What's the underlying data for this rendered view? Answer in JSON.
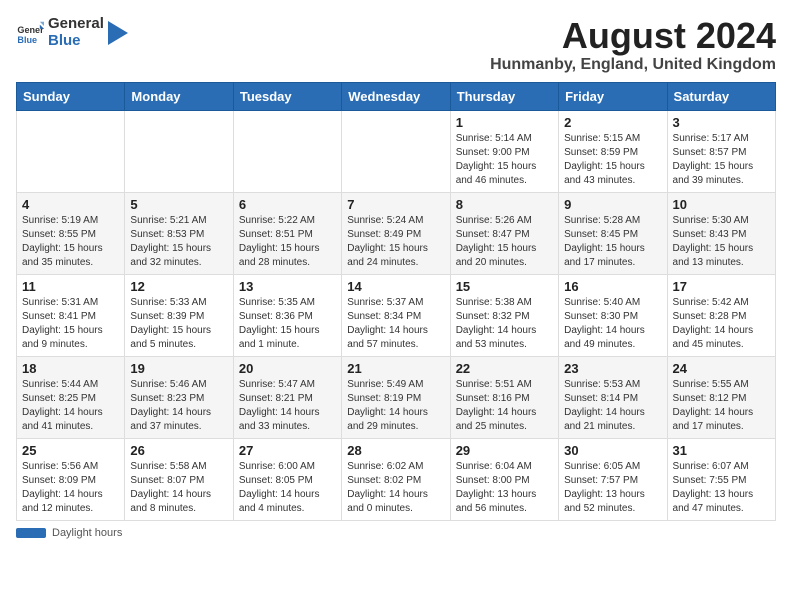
{
  "logo": {
    "general": "General",
    "blue": "Blue"
  },
  "title": "August 2024",
  "location": "Hunmanby, England, United Kingdom",
  "columns": [
    "Sunday",
    "Monday",
    "Tuesday",
    "Wednesday",
    "Thursday",
    "Friday",
    "Saturday"
  ],
  "footer": {
    "bar_label": "Daylight hours"
  },
  "weeks": [
    [
      {
        "num": "",
        "info": ""
      },
      {
        "num": "",
        "info": ""
      },
      {
        "num": "",
        "info": ""
      },
      {
        "num": "",
        "info": ""
      },
      {
        "num": "1",
        "info": "Sunrise: 5:14 AM\nSunset: 9:00 PM\nDaylight: 15 hours\nand 46 minutes."
      },
      {
        "num": "2",
        "info": "Sunrise: 5:15 AM\nSunset: 8:59 PM\nDaylight: 15 hours\nand 43 minutes."
      },
      {
        "num": "3",
        "info": "Sunrise: 5:17 AM\nSunset: 8:57 PM\nDaylight: 15 hours\nand 39 minutes."
      }
    ],
    [
      {
        "num": "4",
        "info": "Sunrise: 5:19 AM\nSunset: 8:55 PM\nDaylight: 15 hours\nand 35 minutes."
      },
      {
        "num": "5",
        "info": "Sunrise: 5:21 AM\nSunset: 8:53 PM\nDaylight: 15 hours\nand 32 minutes."
      },
      {
        "num": "6",
        "info": "Sunrise: 5:22 AM\nSunset: 8:51 PM\nDaylight: 15 hours\nand 28 minutes."
      },
      {
        "num": "7",
        "info": "Sunrise: 5:24 AM\nSunset: 8:49 PM\nDaylight: 15 hours\nand 24 minutes."
      },
      {
        "num": "8",
        "info": "Sunrise: 5:26 AM\nSunset: 8:47 PM\nDaylight: 15 hours\nand 20 minutes."
      },
      {
        "num": "9",
        "info": "Sunrise: 5:28 AM\nSunset: 8:45 PM\nDaylight: 15 hours\nand 17 minutes."
      },
      {
        "num": "10",
        "info": "Sunrise: 5:30 AM\nSunset: 8:43 PM\nDaylight: 15 hours\nand 13 minutes."
      }
    ],
    [
      {
        "num": "11",
        "info": "Sunrise: 5:31 AM\nSunset: 8:41 PM\nDaylight: 15 hours\nand 9 minutes."
      },
      {
        "num": "12",
        "info": "Sunrise: 5:33 AM\nSunset: 8:39 PM\nDaylight: 15 hours\nand 5 minutes."
      },
      {
        "num": "13",
        "info": "Sunrise: 5:35 AM\nSunset: 8:36 PM\nDaylight: 15 hours\nand 1 minute."
      },
      {
        "num": "14",
        "info": "Sunrise: 5:37 AM\nSunset: 8:34 PM\nDaylight: 14 hours\nand 57 minutes."
      },
      {
        "num": "15",
        "info": "Sunrise: 5:38 AM\nSunset: 8:32 PM\nDaylight: 14 hours\nand 53 minutes."
      },
      {
        "num": "16",
        "info": "Sunrise: 5:40 AM\nSunset: 8:30 PM\nDaylight: 14 hours\nand 49 minutes."
      },
      {
        "num": "17",
        "info": "Sunrise: 5:42 AM\nSunset: 8:28 PM\nDaylight: 14 hours\nand 45 minutes."
      }
    ],
    [
      {
        "num": "18",
        "info": "Sunrise: 5:44 AM\nSunset: 8:25 PM\nDaylight: 14 hours\nand 41 minutes."
      },
      {
        "num": "19",
        "info": "Sunrise: 5:46 AM\nSunset: 8:23 PM\nDaylight: 14 hours\nand 37 minutes."
      },
      {
        "num": "20",
        "info": "Sunrise: 5:47 AM\nSunset: 8:21 PM\nDaylight: 14 hours\nand 33 minutes."
      },
      {
        "num": "21",
        "info": "Sunrise: 5:49 AM\nSunset: 8:19 PM\nDaylight: 14 hours\nand 29 minutes."
      },
      {
        "num": "22",
        "info": "Sunrise: 5:51 AM\nSunset: 8:16 PM\nDaylight: 14 hours\nand 25 minutes."
      },
      {
        "num": "23",
        "info": "Sunrise: 5:53 AM\nSunset: 8:14 PM\nDaylight: 14 hours\nand 21 minutes."
      },
      {
        "num": "24",
        "info": "Sunrise: 5:55 AM\nSunset: 8:12 PM\nDaylight: 14 hours\nand 17 minutes."
      }
    ],
    [
      {
        "num": "25",
        "info": "Sunrise: 5:56 AM\nSunset: 8:09 PM\nDaylight: 14 hours\nand 12 minutes."
      },
      {
        "num": "26",
        "info": "Sunrise: 5:58 AM\nSunset: 8:07 PM\nDaylight: 14 hours\nand 8 minutes."
      },
      {
        "num": "27",
        "info": "Sunrise: 6:00 AM\nSunset: 8:05 PM\nDaylight: 14 hours\nand 4 minutes."
      },
      {
        "num": "28",
        "info": "Sunrise: 6:02 AM\nSunset: 8:02 PM\nDaylight: 14 hours\nand 0 minutes."
      },
      {
        "num": "29",
        "info": "Sunrise: 6:04 AM\nSunset: 8:00 PM\nDaylight: 13 hours\nand 56 minutes."
      },
      {
        "num": "30",
        "info": "Sunrise: 6:05 AM\nSunset: 7:57 PM\nDaylight: 13 hours\nand 52 minutes."
      },
      {
        "num": "31",
        "info": "Sunrise: 6:07 AM\nSunset: 7:55 PM\nDaylight: 13 hours\nand 47 minutes."
      }
    ]
  ]
}
